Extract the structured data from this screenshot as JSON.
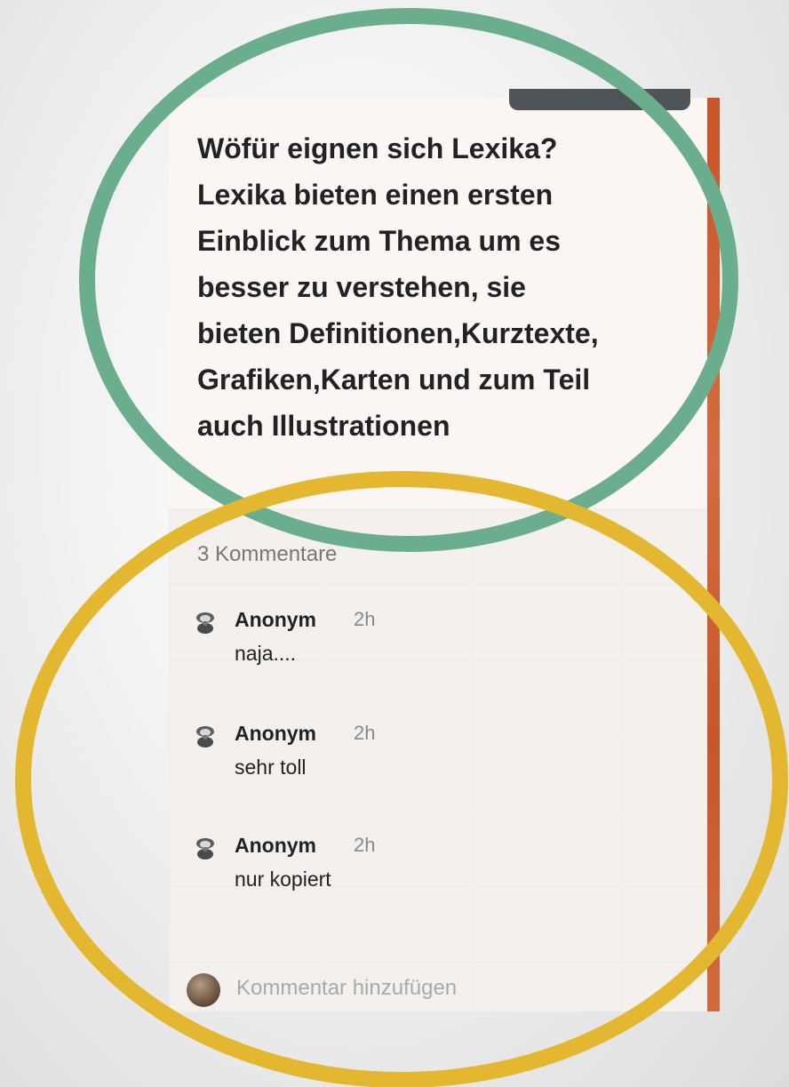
{
  "post": {
    "lines": [
      "Wöfür eignen sich Lexika?",
      "Lexika bieten einen ersten",
      "Einblick zum Thema um es",
      "besser zu verstehen, sie",
      "bieten Definitionen,Kurztexte,",
      "Grafiken,Karten und zum Teil",
      "auch Illustrationen"
    ]
  },
  "comments_count": "3 Kommentare",
  "comments": [
    {
      "author": "Anonym",
      "time": "2h",
      "text": "naja...."
    },
    {
      "author": "Anonym",
      "time": "2h",
      "text": "sehr toll"
    },
    {
      "author": "Anonym",
      "time": "2h",
      "text": "nur kopiert"
    }
  ],
  "add_comment": {
    "placeholder": "Kommentar hinzufügen"
  },
  "colors": {
    "green_circle": "#6aae8e",
    "yellow_circle": "#e3b72f",
    "accent_edge": "#c9552b"
  },
  "icons": {
    "comment_avatar": "anonymous-avatar-icon",
    "user_avatar": "user-avatar"
  }
}
